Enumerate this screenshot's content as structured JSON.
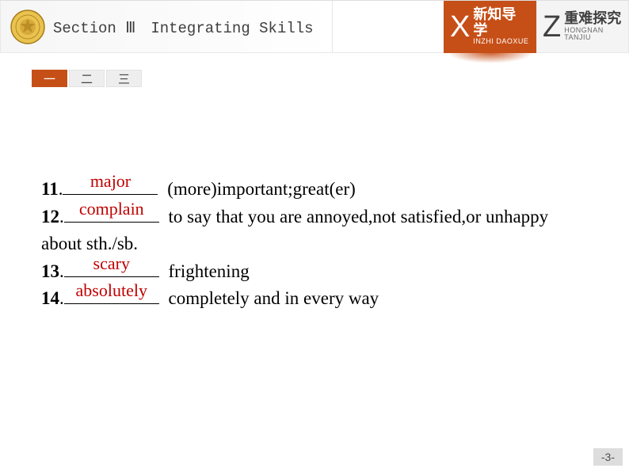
{
  "header": {
    "sectionTitle": "Section Ⅲ　Integrating Skills",
    "tabs": [
      {
        "letter": "X",
        "cn": "新知导学",
        "en": "INZHI DAOXUE",
        "active": true
      },
      {
        "letter": "Z",
        "cn": "重难探究",
        "en": "HONGNAN TANJIU",
        "active": false
      }
    ]
  },
  "subtabs": [
    "一",
    "二",
    "三"
  ],
  "activeSubtab": 0,
  "items": [
    {
      "num": "11",
      "answer": "major",
      "def": " (more)important;great(er)"
    },
    {
      "num": "12",
      "answer": "complain",
      "def": " to say that you are annoyed,not satisfied,or unhappy about sth./sb."
    },
    {
      "num": "13",
      "answer": "scary",
      "def": " frightening"
    },
    {
      "num": "14",
      "answer": "absolutely",
      "def": " completely and in every way"
    }
  ],
  "pageNumber": "-3-"
}
